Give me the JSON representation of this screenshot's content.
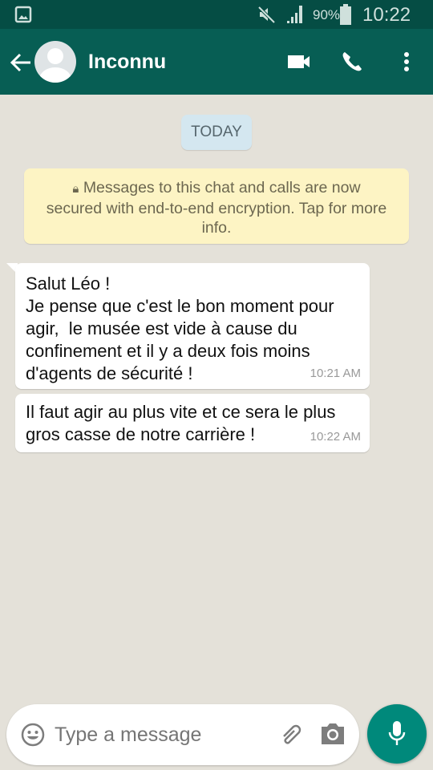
{
  "status_bar": {
    "battery": "90%",
    "time": "10:22",
    "icons": [
      "image-icon",
      "mute-icon",
      "signal-icon",
      "battery-icon"
    ]
  },
  "header": {
    "contact_name": "Inconnu",
    "icons": [
      "back-arrow-icon",
      "avatar",
      "video-call-icon",
      "phone-icon",
      "more-vert-icon"
    ]
  },
  "chat": {
    "date_label": "TODAY",
    "encryption_notice": {
      "lines": [
        "Messages to this chat and calls are now",
        "secured with end-to-end encryption. Tap for more",
        "info."
      ]
    },
    "messages": [
      {
        "lines": [
          "Salut Léo !",
          "Je pense que c'est le bon moment pour",
          "agir,  le musée est vide à cause du",
          "confinement et il y a deux fois moins",
          "d'agents de sécurité !"
        ],
        "time": "10:21 AM"
      },
      {
        "lines": [
          "Il faut agir au plus vite et ce sera le plus",
          "gros casse de notre carrière !"
        ],
        "time": "10:22 AM"
      }
    ]
  },
  "composer": {
    "placeholder": "Type a message",
    "icons": [
      "emoji-icon",
      "attach-icon",
      "camera-icon",
      "mic-icon"
    ]
  },
  "colors": {
    "header": "#075e54",
    "status_bar": "#054d44",
    "mic_button": "#00897b",
    "encryption_bg": "#fdf4c4",
    "date_bg": "#d4e7f0"
  }
}
